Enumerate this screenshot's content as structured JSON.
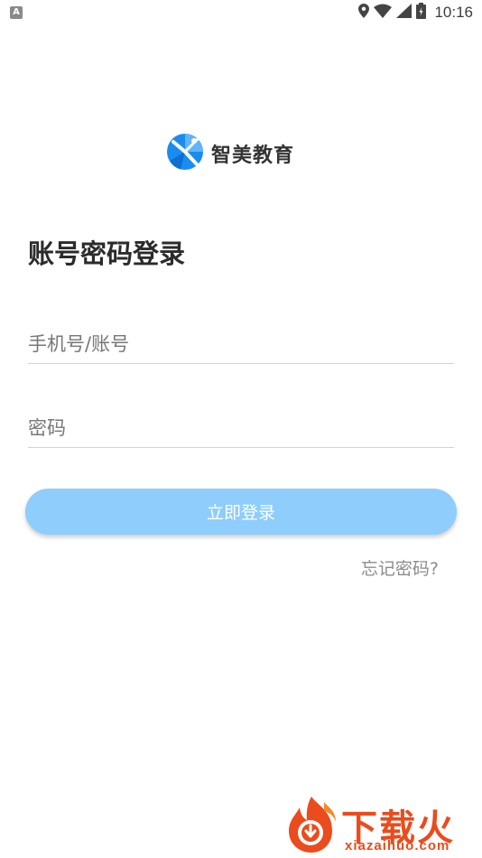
{
  "status_bar": {
    "notification_icon": "A",
    "icons": [
      "location-icon",
      "wifi-icon",
      "signal-icon",
      "battery-icon"
    ],
    "time": "10:16"
  },
  "logo": {
    "name": "智美教育",
    "brand_color": "#1a8cf0"
  },
  "page": {
    "title": "账号密码登录"
  },
  "form": {
    "account_placeholder": "手机号/账号",
    "password_placeholder": "密码",
    "login_label": "立即登录",
    "forgot_label": "忘记密码?"
  },
  "colors": {
    "button": "#8ecdfc",
    "watermark": "#ea4c1d"
  },
  "watermark": {
    "title": "下载火",
    "subtitle": "xiazaihuo.com"
  }
}
